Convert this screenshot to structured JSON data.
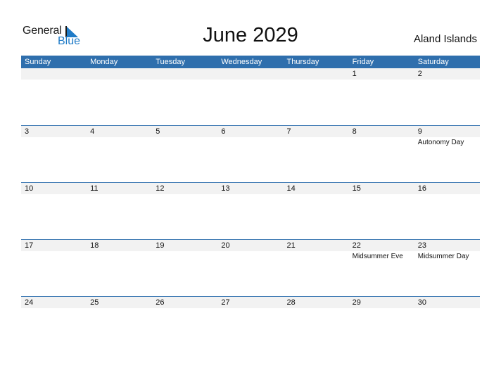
{
  "logo": {
    "word1": "General",
    "word2": "Blue"
  },
  "header": {
    "title": "June 2029",
    "country": "Aland Islands"
  },
  "weekdays": [
    "Sunday",
    "Monday",
    "Tuesday",
    "Wednesday",
    "Thursday",
    "Friday",
    "Saturday"
  ],
  "weeks": [
    {
      "days": [
        "",
        "",
        "",
        "",
        "",
        "1",
        "2"
      ],
      "holidays": [
        "",
        "",
        "",
        "",
        "",
        "",
        ""
      ]
    },
    {
      "days": [
        "3",
        "4",
        "5",
        "6",
        "7",
        "8",
        "9"
      ],
      "holidays": [
        "",
        "",
        "",
        "",
        "",
        "",
        "Autonomy Day"
      ]
    },
    {
      "days": [
        "10",
        "11",
        "12",
        "13",
        "14",
        "15",
        "16"
      ],
      "holidays": [
        "",
        "",
        "",
        "",
        "",
        "",
        ""
      ]
    },
    {
      "days": [
        "17",
        "18",
        "19",
        "20",
        "21",
        "22",
        "23"
      ],
      "holidays": [
        "",
        "",
        "",
        "",
        "",
        "Midsummer Eve",
        "Midsummer Day"
      ]
    },
    {
      "days": [
        "24",
        "25",
        "26",
        "27",
        "28",
        "29",
        "30"
      ],
      "holidays": [
        "",
        "",
        "",
        "",
        "",
        "",
        ""
      ]
    }
  ],
  "colors": {
    "accent": "#2f6fad",
    "logo_blue": "#1f7bc7",
    "day_bar": "#f2f2f2"
  }
}
